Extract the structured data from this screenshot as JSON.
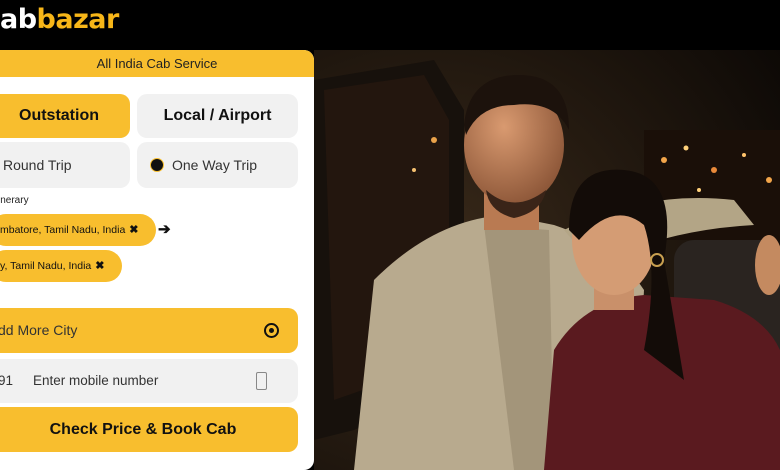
{
  "brand": {
    "logo_white": "ab",
    "logo_yellow": "bazar"
  },
  "banner": "All India Cab Service",
  "tabs": {
    "outstation": "Outstation",
    "local": "Local / Airport"
  },
  "trip": {
    "round": "Round Trip",
    "one_way": "One Way Trip"
  },
  "itinerary_label": "inerary",
  "cities": [
    {
      "label": "mbatore, Tamil Nadu, India"
    },
    {
      "label": "y, Tamil Nadu, India"
    }
  ],
  "add_city": "dd More City",
  "mobile": {
    "code": "91",
    "placeholder": "Enter mobile number"
  },
  "cta": "Check Price & Book Cab",
  "colors": {
    "accent": "#f8be2e",
    "field_bg": "#f1f1f1"
  }
}
